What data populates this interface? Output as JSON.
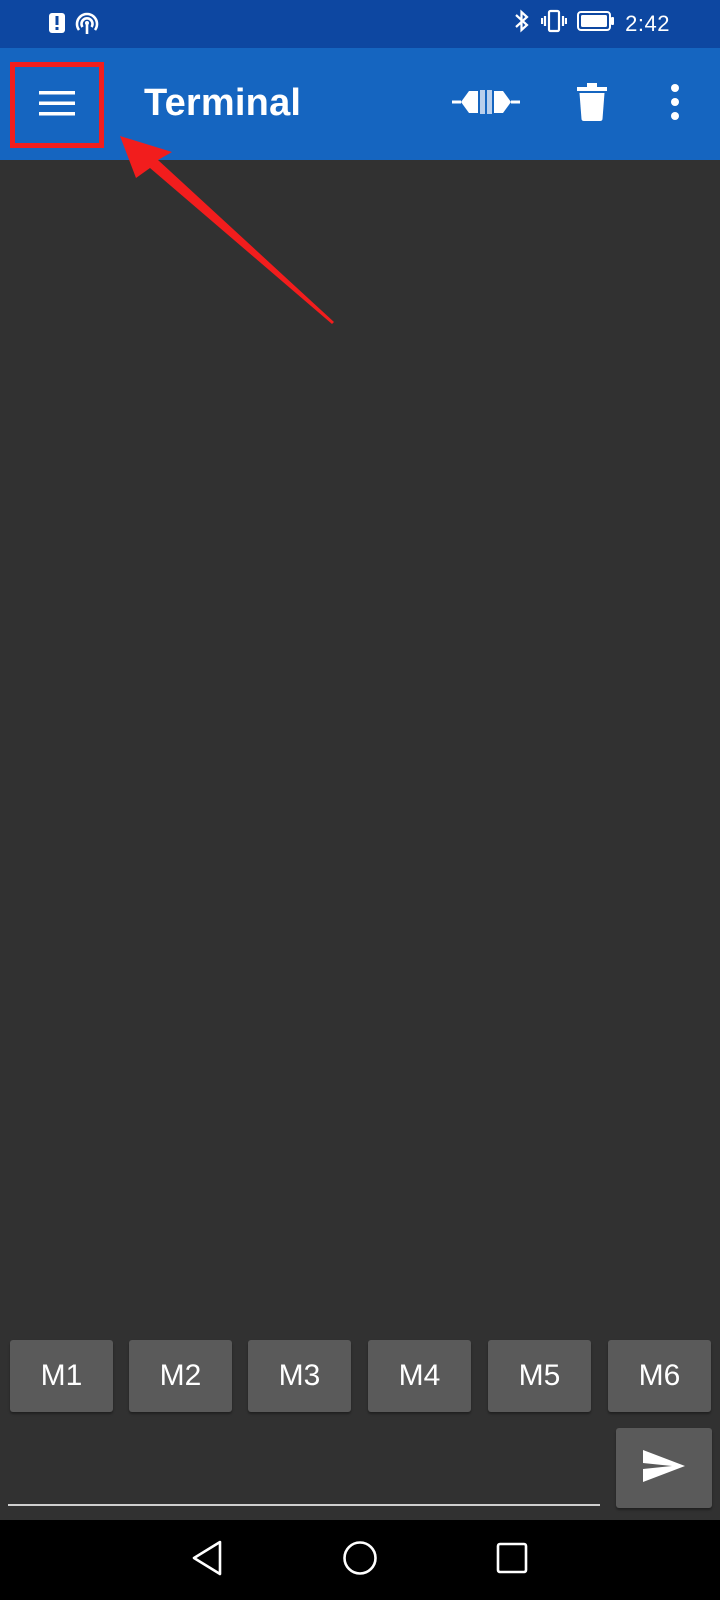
{
  "status_bar": {
    "time": "2:42",
    "icons": [
      "alert-icon",
      "hotspot-icon",
      "bluetooth-icon",
      "vibrate-icon",
      "battery-icon"
    ]
  },
  "app_bar": {
    "title": "Terminal",
    "background": "#1565C0",
    "icons": [
      "menu-icon",
      "connect-icon",
      "delete-icon",
      "overflow-icon"
    ]
  },
  "annotation": {
    "highlight_color": "#F21D1D"
  },
  "terminal": {
    "background": "#313131",
    "output": ""
  },
  "macros": [
    {
      "label": "M1"
    },
    {
      "label": "M2"
    },
    {
      "label": "M3"
    },
    {
      "label": "M4"
    },
    {
      "label": "M5"
    },
    {
      "label": "M6"
    }
  ],
  "input": {
    "value": "",
    "placeholder": ""
  },
  "nav_bar": {
    "icons": [
      "back-icon",
      "home-icon",
      "recent-apps-icon"
    ]
  }
}
